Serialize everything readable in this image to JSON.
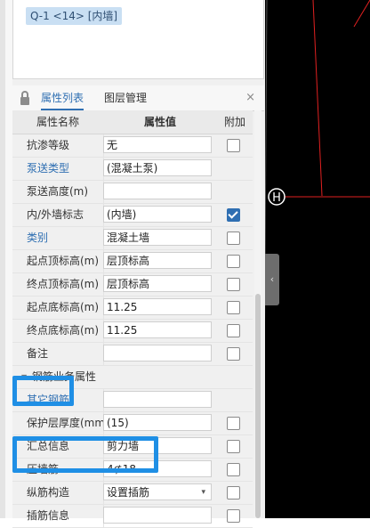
{
  "selection": {
    "label": "Q-1 <14> [内墙]"
  },
  "tabs": {
    "properties": "属性列表",
    "layers": "图层管理",
    "close": "×"
  },
  "table": {
    "headers": {
      "name": "属性名称",
      "value": "属性值",
      "extra": "附加"
    },
    "rows": [
      {
        "name": "抗渗等级",
        "value": "无",
        "checkbox": true,
        "checked": false,
        "link": false
      },
      {
        "name": "泵送类型",
        "value": "(混凝土泵)",
        "checkbox": false,
        "checked": false,
        "link": true
      },
      {
        "name": "泵送高度(m)",
        "value": "",
        "checkbox": false,
        "checked": false,
        "link": false
      },
      {
        "name": "内/外墙标志",
        "value": "(内墙)",
        "checkbox": true,
        "checked": true,
        "link": false
      },
      {
        "name": "类别",
        "value": "混凝土墙",
        "checkbox": true,
        "checked": false,
        "link": true
      },
      {
        "name": "起点顶标高(m)",
        "value": "层顶标高",
        "checkbox": true,
        "checked": false,
        "link": false
      },
      {
        "name": "终点顶标高(m)",
        "value": "层顶标高",
        "checkbox": true,
        "checked": false,
        "link": false
      },
      {
        "name": "起点底标高(m)",
        "value": "11.25",
        "checkbox": true,
        "checked": false,
        "link": false
      },
      {
        "name": "终点底标高(m)",
        "value": "11.25",
        "checkbox": true,
        "checked": false,
        "link": false
      },
      {
        "name": "备注",
        "value": "",
        "checkbox": true,
        "checked": false,
        "link": false
      }
    ],
    "group": {
      "label": "钢筋业务属性",
      "expand_icon": "triangle-down-icon"
    },
    "group_rows": [
      {
        "name": "其它钢筋",
        "value": "",
        "checkbox": false,
        "checked": false,
        "link": true
      },
      {
        "name": "保护层厚度(mm)",
        "value": "(15)",
        "checkbox": true,
        "checked": false,
        "link": false
      },
      {
        "name": "汇总信息",
        "value": "剪力墙",
        "checkbox": true,
        "checked": false,
        "link": false
      },
      {
        "name": "压墙筋",
        "value": "4⊈18",
        "checkbox": true,
        "checked": false,
        "link": false
      },
      {
        "name": "纵筋构造",
        "value": "设置插筋",
        "checkbox": true,
        "checked": false,
        "link": false,
        "dropdown": true
      },
      {
        "name": "插筋信息",
        "value": "",
        "checkbox": true,
        "checked": false,
        "link": false
      }
    ]
  },
  "canvas": {
    "axis_label": "H"
  },
  "colors": {
    "accent": "#2f6fb2",
    "highlight": "#1f8fe5",
    "canvas_bg": "#000000",
    "wall_line": "#e02020",
    "axis_line": "#ffffff"
  }
}
